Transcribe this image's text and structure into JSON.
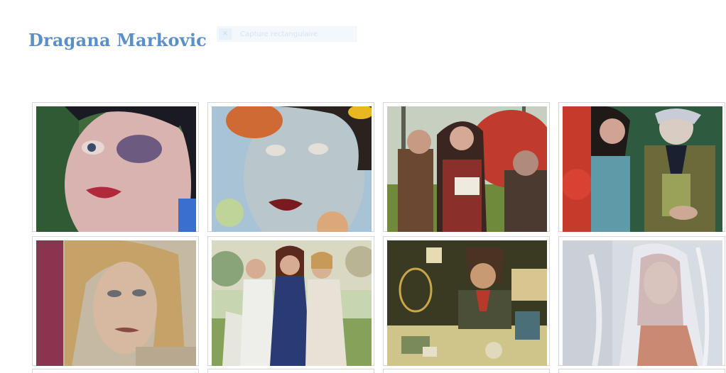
{
  "site": {
    "title": "Dragana Markovic"
  },
  "capture": {
    "label": "Capture rectangulaire",
    "icon": "rect-capture-icon"
  },
  "gallery": {
    "items": [
      {
        "name": "painting-woman-closeup",
        "icon": "painting-thumbnail"
      },
      {
        "name": "painting-woman-parted-lips",
        "icon": "painting-thumbnail"
      },
      {
        "name": "painting-trio-forest",
        "icon": "painting-thumbnail"
      },
      {
        "name": "painting-woman-old-man",
        "icon": "painting-thumbnail"
      },
      {
        "name": "painting-woman-profile",
        "icon": "painting-thumbnail"
      },
      {
        "name": "painting-three-women",
        "icon": "painting-thumbnail"
      },
      {
        "name": "painting-man-birdcage",
        "icon": "painting-thumbnail"
      },
      {
        "name": "painting-veiled-woman",
        "icon": "painting-thumbnail"
      }
    ]
  },
  "colors": {
    "title": "#5b8fc9",
    "tile_border": "#d6d6d6"
  }
}
